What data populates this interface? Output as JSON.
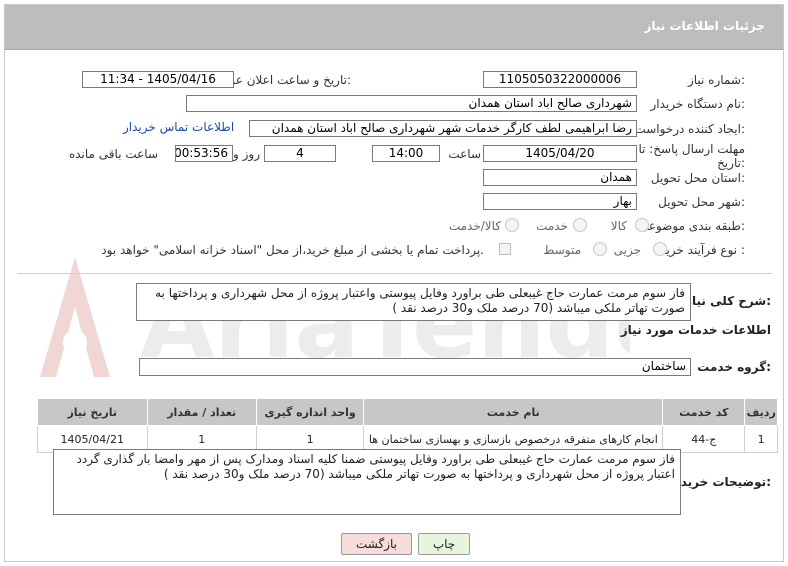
{
  "header": {
    "title": "جزئیات اطلاعات نیاز"
  },
  "form": {
    "need_number_label": "شماره نیاز:",
    "need_number": "1105050322000006",
    "announce_label": "تاریخ و ساعت اعلان عمومی:",
    "announce_value": "1405/04/16 - 11:34",
    "buyer_org_label": "نام دستگاه خریدار:",
    "buyer_org": "شهرداری صالح اباد استان همدان",
    "requester_label": "ایجاد کننده درخواست:",
    "requester": "رضا ابراهیمی لطف کارگر خدمات شهر شهرداری صالح اباد استان همدان",
    "buyer_contact_link": "اطلاعات تماس خریدار",
    "deadline_label_1": "مهلت ارسال پاسخ: تا",
    "deadline_label_2": "تاریخ:",
    "deadline_date": "1405/04/20",
    "time_label": "ساعت",
    "deadline_time": "14:00",
    "days_value": "4",
    "days_label": "روز و",
    "remaining_time": "00:53:56",
    "remaining_label": "ساعت باقی مانده",
    "province_label": "استان محل تحویل:",
    "province": "همدان",
    "city_label": "شهر محل تحویل:",
    "city": "بهار",
    "category_label": "طبقه بندی موضوعی:",
    "category_options": [
      "کالا",
      "خدمت",
      "کالا/خدمت"
    ],
    "process_label": "نوع فرآیند خرید :",
    "process_options": [
      "جزیی",
      "متوسط"
    ],
    "payment_note": "پرداخت تمام یا بخشی از مبلغ خرید،از محل \"اسناد خزانه اسلامی\" خواهد بود."
  },
  "summary": {
    "label": "شرح کلی نیاز:",
    "text": "فاز سوم مرمت عمارت حاج غیبعلی طی براورد وفایل پیوستی واعتبار پروژه از محل شهرداری و پرداختها به صورت تهاتر ملکی میباشد (70 درصد ملک و30 درصد نقد )"
  },
  "services": {
    "section_title": "اطلاعات خدمات مورد نیاز",
    "group_label": "گروه خدمت:",
    "group_value": "ساختمان",
    "columns": [
      "ردیف",
      "کد خدمت",
      "نام خدمت",
      "واحد اندازه گیری",
      "تعداد / مقدار",
      "تاریخ نیاز"
    ],
    "rows": [
      [
        "1",
        "ج-44",
        "انجام کارهای متفرقه درخصوص بازسازی و بهسازی ساختمان ها",
        "1",
        "1",
        "1405/04/21"
      ]
    ]
  },
  "buyer_notes": {
    "label": "توضیحات خریدار:",
    "text": "فاز سوم مرمت عمارت حاج غیبعلی طی براورد وفایل پیوستی ضمنا کلیه اسناد ومدارک پس از مهر وامضا بار گذاری گردد اعتبار پروژه از محل شهرداری و پرداختها به صورت تهاتر ملکی میباشد (70 درصد ملک و30 درصد نقد )"
  },
  "buttons": {
    "print": "چاپ",
    "back": "بازگشت"
  },
  "watermark": {
    "text": "AriaTender.neT"
  },
  "colors": {
    "header_bg": "#bdbdbd",
    "link": "#1a4fa0",
    "print_btn": "#e6f5dc",
    "back_btn": "#f7dcdc"
  }
}
